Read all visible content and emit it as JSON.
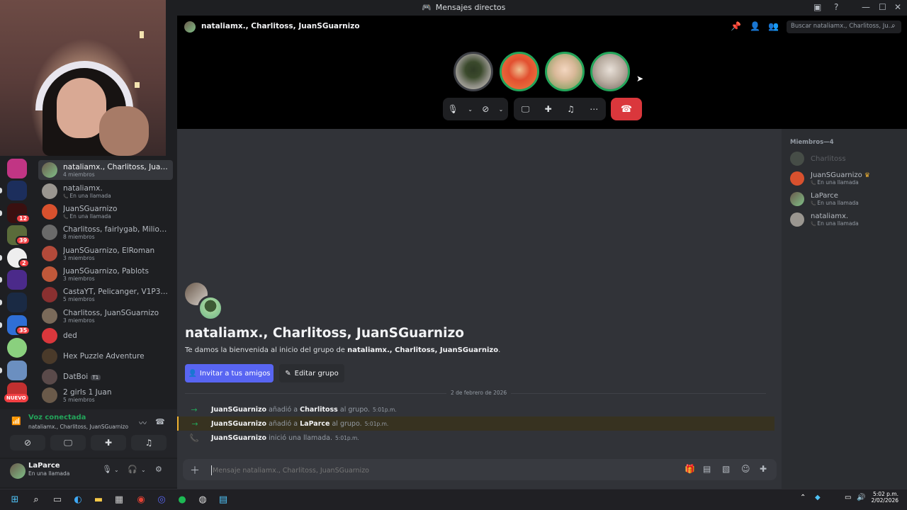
{
  "window": {
    "title": "Mensajes directos"
  },
  "header": {
    "title": "nataliamx., Charlitoss, JuanSGuarnizo",
    "search_placeholder": "Buscar nataliamx., Charlitoss, Ju..."
  },
  "servers": {
    "badges": [
      "12",
      "39",
      "2",
      "35"
    ],
    "nuevo": "NUEVO"
  },
  "dms": [
    {
      "name": "nataliamx., Charlitoss, JuanSG...",
      "sub": "4 miembros",
      "active": true
    },
    {
      "name": "nataliamx.",
      "sub": "En una llamada",
      "call": true
    },
    {
      "name": "JuanSGuarnizo",
      "sub": "En una llamada",
      "call": true
    },
    {
      "name": "Charlitoss, fairlygab, MilioG, N...",
      "sub": "8 miembros"
    },
    {
      "name": "JuanSGuarnizo, ElRoman",
      "sub": "3 miembros"
    },
    {
      "name": "JuanSGuarnizo, Pablots",
      "sub": "3 miembros"
    },
    {
      "name": "CastaYT, Pelicanger, V1P3R, so...",
      "sub": "5 miembros"
    },
    {
      "name": "Charlitoss, JuanSGuarnizo",
      "sub": "3 miembros"
    },
    {
      "name": "ded",
      "sub": ""
    },
    {
      "name": "Hex Puzzle Adventure",
      "sub": ""
    },
    {
      "name": "DatBoi",
      "sub": "",
      "tag": "T1"
    },
    {
      "name": "2 girls 1 Juan",
      "sub": "5 miembros"
    }
  ],
  "voice": {
    "status": "Voz conectada",
    "channel": "nataliamx., Charlitoss, JuanSGuarnizo"
  },
  "user": {
    "name": "LaParce",
    "status": "En una llamada"
  },
  "members": {
    "heading": "Miembros—4",
    "list": [
      {
        "name": "Charlitoss",
        "sub": "",
        "offline": true
      },
      {
        "name": "JuanSGuarnizo",
        "sub": "En una llamada",
        "owner": true
      },
      {
        "name": "LaParce",
        "sub": "En una llamada"
      },
      {
        "name": "nataliamx.",
        "sub": "En una llamada"
      }
    ]
  },
  "welcome": {
    "title": "nataliamx., Charlitoss, JuanSGuarnizo",
    "desc_prefix": "Te damos la bienvenida al inicio del grupo de ",
    "desc_group": "nataliamx., Charlitoss, JuanSGuarnizo",
    "desc_suffix": ".",
    "invite_label": "Invitar a tus amigos",
    "edit_label": "Editar grupo"
  },
  "date_divider": "2 de febrero de 2026",
  "system_messages": [
    {
      "actor": "JuanSGuarnizo",
      "verb": "añadió a",
      "target": "Charlitoss",
      "rest": "al grupo.",
      "time": "5:01p.m."
    },
    {
      "actor": "JuanSGuarnizo",
      "verb": "añadió a",
      "target": "LaParce",
      "rest": "al grupo.",
      "time": "5:01p.m."
    },
    {
      "actor": "JuanSGuarnizo",
      "verb": "inició una llamada.",
      "target": "",
      "rest": "",
      "time": "5:01p.m."
    }
  ],
  "composer": {
    "placeholder": "Mensaje nataliamx., Charlitoss, JuanSGuarnizo"
  },
  "clock": {
    "time": "5:02 p.m.",
    "date": "2/02/2026"
  },
  "colors": {
    "accent": "#5865f2",
    "danger": "#da373c",
    "online": "#23a55a",
    "mention": "#f0b232"
  }
}
